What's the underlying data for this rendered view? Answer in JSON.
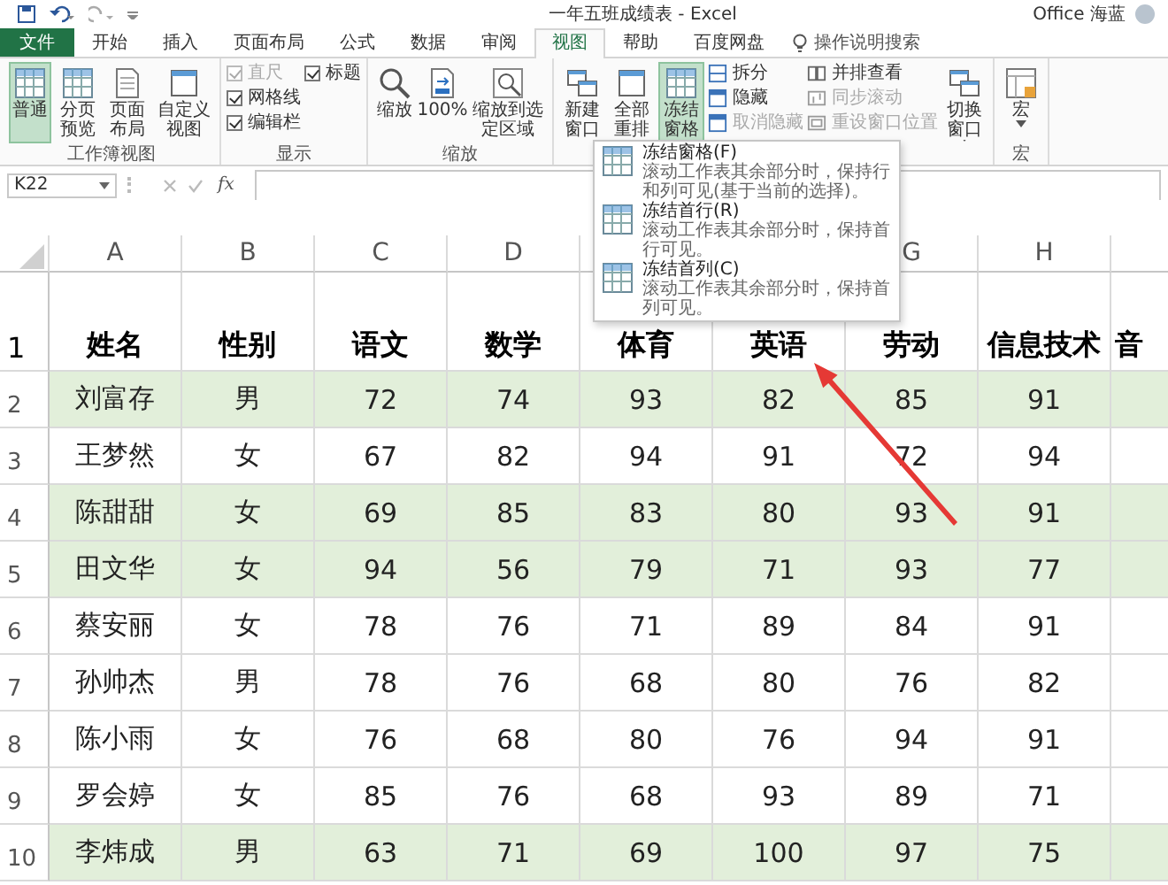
{
  "title_bar": {
    "document_title": "一年五班成绩表 - Excel",
    "user": "Office 海蓝"
  },
  "ribbon_tabs": [
    {
      "label": "文件",
      "kind": "file",
      "selected": false
    },
    {
      "label": "开始",
      "kind": "tab",
      "selected": false
    },
    {
      "label": "插入",
      "kind": "tab",
      "selected": false
    },
    {
      "label": "页面布局",
      "kind": "tab",
      "selected": false
    },
    {
      "label": "公式",
      "kind": "tab",
      "selected": false
    },
    {
      "label": "数据",
      "kind": "tab",
      "selected": false
    },
    {
      "label": "审阅",
      "kind": "tab",
      "selected": false
    },
    {
      "label": "视图",
      "kind": "tab",
      "selected": true
    },
    {
      "label": "帮助",
      "kind": "tab",
      "selected": false
    },
    {
      "label": "百度网盘",
      "kind": "tab",
      "selected": false
    }
  ],
  "tell_me": "操作说明搜索",
  "ribbon_groups": [
    {
      "label": "工作簿视图",
      "controls": [
        {
          "kind": "large",
          "label": "普通",
          "selected": true
        },
        {
          "kind": "large",
          "label": "分页预览",
          "selected": false
        },
        {
          "kind": "large",
          "label": "页面布局",
          "selected": false
        },
        {
          "kind": "large",
          "label": "自定义视图",
          "selected": false
        }
      ]
    },
    {
      "label": "显示",
      "controls": [
        {
          "kind": "checkbox",
          "label": "直尺",
          "checked": true,
          "disabled": true
        },
        {
          "kind": "checkbox",
          "label": "网格线",
          "checked": true,
          "disabled": false
        },
        {
          "kind": "checkbox",
          "label": "编辑栏",
          "checked": true,
          "disabled": false
        },
        {
          "kind": "checkbox",
          "label": "标题",
          "checked": true,
          "disabled": false
        }
      ]
    },
    {
      "label": "缩放",
      "controls": [
        {
          "kind": "large",
          "label": "缩放",
          "selected": false
        },
        {
          "kind": "large",
          "label": "100%",
          "selected": false
        },
        {
          "kind": "large",
          "label": "缩放到选定区域",
          "selected": false
        }
      ]
    },
    {
      "controls": [
        {
          "kind": "large",
          "label": "新建窗口",
          "selected": false
        },
        {
          "kind": "large",
          "label": "全部重排",
          "selected": false
        },
        {
          "kind": "large",
          "label": "冻结窗格",
          "selected": true,
          "dropdown": true
        },
        {
          "kind": "small",
          "label": "拆分",
          "disabled": false
        },
        {
          "kind": "small",
          "label": "隐藏",
          "disabled": false
        },
        {
          "kind": "small",
          "label": "取消隐藏",
          "disabled": true
        },
        {
          "kind": "small",
          "label": "并排查看",
          "disabled": false
        },
        {
          "kind": "small",
          "label": "同步滚动",
          "disabled": true
        },
        {
          "kind": "small",
          "label": "重设窗口位置",
          "disabled": true
        },
        {
          "kind": "large",
          "label": "切换窗口",
          "selected": false,
          "dropdown": true
        }
      ]
    },
    {
      "label": "宏",
      "controls": [
        {
          "kind": "large",
          "label": "宏",
          "selected": false,
          "dropdown": true
        }
      ]
    }
  ],
  "formula_bar": {
    "name_box": "K22",
    "function_button": "fx"
  },
  "sheet": {
    "columns": [
      {
        "label": "A"
      },
      {
        "label": "B"
      },
      {
        "label": "C"
      },
      {
        "label": "D"
      },
      {},
      {},
      {
        "label": "G"
      },
      {
        "label": "H"
      }
    ],
    "header_row": {
      "number": "1",
      "cells": [
        "姓名",
        "性别",
        "语文",
        "数学",
        "体育",
        "英语",
        "劳动",
        "信息技术",
        "音"
      ]
    },
    "rows": [
      {
        "number": "2",
        "highlighted": true,
        "cells": [
          "刘富存",
          "男",
          "72",
          "74",
          "93",
          "82",
          "85",
          "91"
        ]
      },
      {
        "number": "3",
        "highlighted": false,
        "cells": [
          "王梦然",
          "女",
          "67",
          "82",
          "94",
          "91",
          "72",
          "94"
        ]
      },
      {
        "number": "4",
        "highlighted": true,
        "cells": [
          "陈甜甜",
          "女",
          "69",
          "85",
          "83",
          "80",
          "93",
          "91"
        ]
      },
      {
        "number": "5",
        "highlighted": true,
        "cells": [
          "田文华",
          "女",
          "94",
          "56",
          "79",
          "71",
          "93",
          "77"
        ]
      },
      {
        "number": "6",
        "highlighted": false,
        "cells": [
          "蔡安丽",
          "女",
          "78",
          "76",
          "71",
          "89",
          "84",
          "91"
        ]
      },
      {
        "number": "7",
        "highlighted": false,
        "cells": [
          "孙帅杰",
          "男",
          "78",
          "76",
          "68",
          "80",
          "76",
          "82"
        ]
      },
      {
        "number": "8",
        "highlighted": false,
        "cells": [
          "陈小雨",
          "女",
          "76",
          "68",
          "80",
          "76",
          "94",
          "91"
        ]
      },
      {
        "number": "9",
        "highlighted": false,
        "cells": [
          "罗会婷",
          "女",
          "85",
          "76",
          "68",
          "93",
          "89",
          "71"
        ]
      },
      {
        "number": "10",
        "highlighted": true,
        "cells": [
          "李炜成",
          "男",
          "63",
          "71",
          "69",
          "100",
          "97",
          "75"
        ]
      }
    ]
  },
  "freeze_menu": {
    "items": [
      {
        "title": "冻结窗格(F)",
        "description": "滚动工作表其余部分时，保持行和列可见(基于当前的选择)。"
      },
      {
        "title": "冻结首行(R)",
        "description": "滚动工作表其余部分时，保持首行可见。"
      },
      {
        "title": "冻结首列(C)",
        "description": "滚动工作表其余部分时，保持首列可见。"
      }
    ]
  }
}
